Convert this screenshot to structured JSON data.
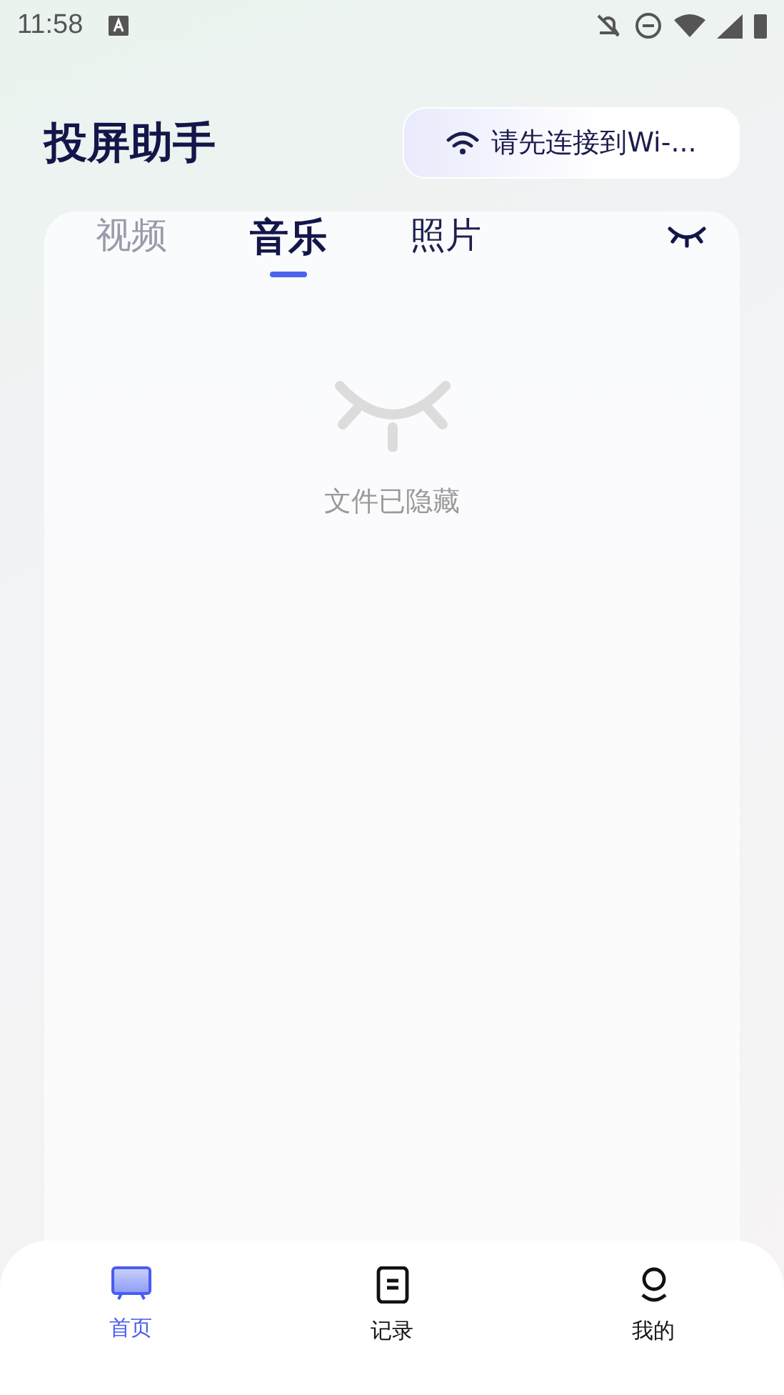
{
  "status_bar": {
    "time": "11:58"
  },
  "header": {
    "title": "投屏助手",
    "wifi_button": "请先连接到Wi-..."
  },
  "tabs": [
    {
      "label": "视频",
      "selected": false
    },
    {
      "label": "音乐",
      "selected": true
    },
    {
      "label": "照片",
      "selected": false
    }
  ],
  "empty_state": {
    "message": "文件已隐藏"
  },
  "bottom_nav": [
    {
      "label": "首页",
      "kind": "home",
      "selected": true
    },
    {
      "label": "记录",
      "kind": "records",
      "selected": false
    },
    {
      "label": "我的",
      "kind": "profile",
      "selected": false
    }
  ]
}
